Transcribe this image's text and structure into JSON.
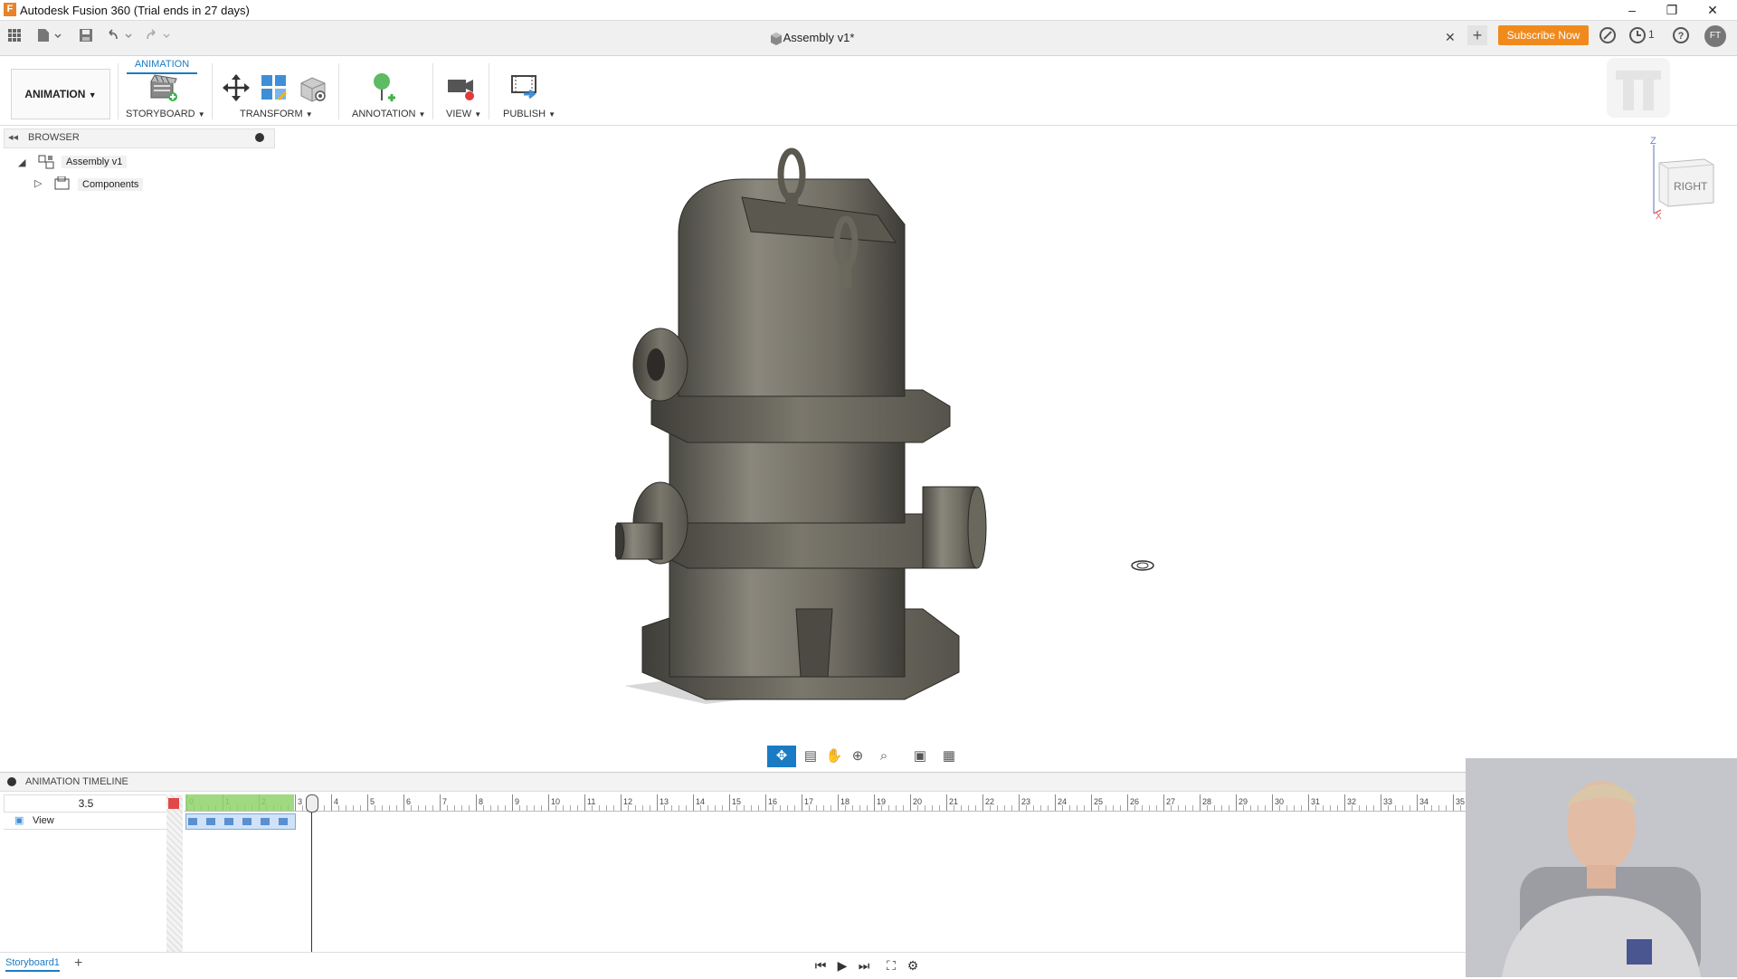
{
  "window": {
    "title": "Autodesk Fusion 360 (Trial ends in 27 days)",
    "app_icon_glyph": "F",
    "minimize": "–",
    "restore": "❐",
    "close": "✕"
  },
  "quick_access": {
    "doc_name": "Assembly v1*",
    "subscribe_label": "Subscribe Now",
    "jobs_count": "1",
    "user_initials": "FT"
  },
  "ribbon": {
    "active_tab": "ANIMATION",
    "workspace_label": "ANIMATION",
    "groups": {
      "storyboard": "STORYBOARD",
      "transform": "TRANSFORM",
      "annotation": "ANNOTATION",
      "view": "VIEW",
      "publish": "PUBLISH"
    }
  },
  "browser": {
    "title": "BROWSER",
    "root": "Assembly v1",
    "components": "Components"
  },
  "viewcube": {
    "face": "RIGHT",
    "axis_z": "Z",
    "axis_x": "X"
  },
  "timeline": {
    "title": "ANIMATION TIMELINE",
    "current_time": "3.5",
    "track_name": "View",
    "ruler_ticks": [
      "0",
      "1",
      "2",
      "3",
      "4",
      "5",
      "6",
      "7",
      "8",
      "9",
      "10",
      "11",
      "12",
      "13",
      "14",
      "15",
      "16",
      "17",
      "18",
      "19",
      "20",
      "21",
      "22",
      "23",
      "24",
      "25",
      "26",
      "27",
      "28",
      "29",
      "30",
      "31",
      "32",
      "33",
      "34",
      "35"
    ],
    "storyboard_tab": "Storyboard1",
    "add_tab": "+"
  },
  "colors": {
    "accent": "#1a7bc4",
    "subscribe": "#f08a1c",
    "timeline_green": "#8fd46a"
  }
}
